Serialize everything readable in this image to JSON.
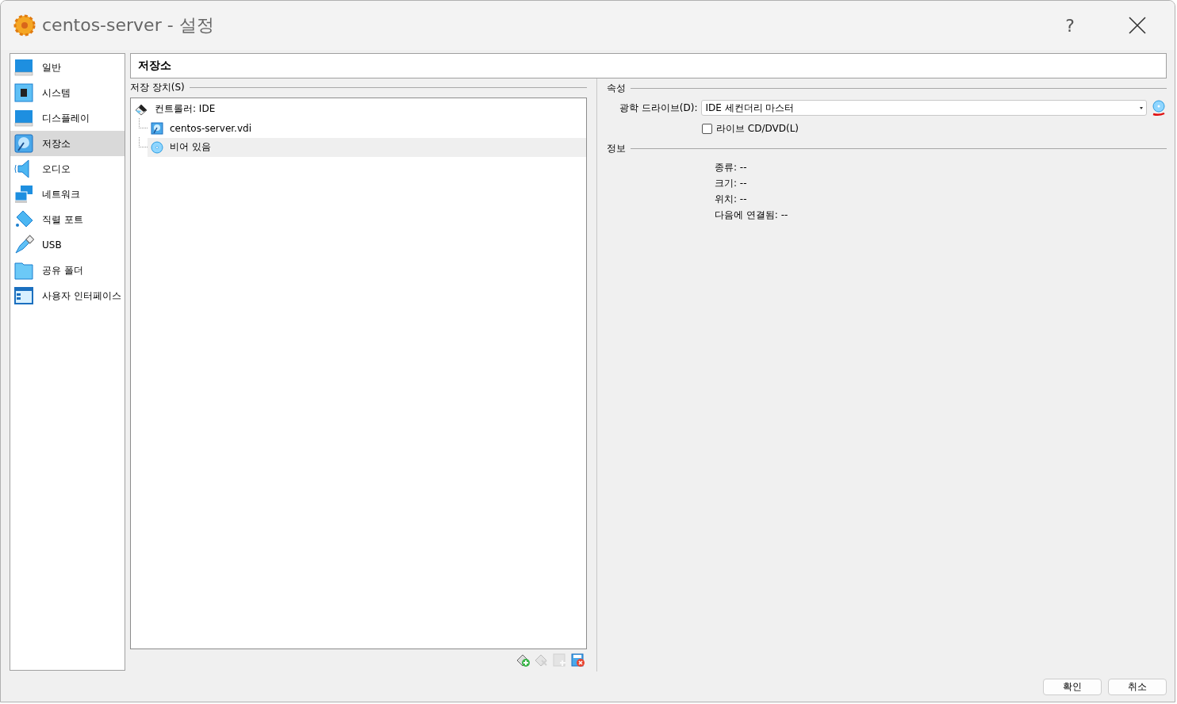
{
  "window": {
    "title": "centos-server - 설정",
    "help": "?"
  },
  "sidebar": {
    "items": [
      {
        "label": "일반",
        "selected": false
      },
      {
        "label": "시스템",
        "selected": false
      },
      {
        "label": "디스플레이",
        "selected": false
      },
      {
        "label": "저장소",
        "selected": true
      },
      {
        "label": "오디오",
        "selected": false
      },
      {
        "label": "네트워크",
        "selected": false
      },
      {
        "label": "직렬 포트",
        "selected": false
      },
      {
        "label": "USB",
        "selected": false
      },
      {
        "label": "공유 폴더",
        "selected": false
      },
      {
        "label": "사용자 인터페이스",
        "selected": false
      }
    ]
  },
  "page_title": "저장소",
  "storage": {
    "title": "저장 장치(S)",
    "tree": [
      {
        "label": "컨트롤러: IDE",
        "kind": "controller",
        "selected": false,
        "children": [
          {
            "label": "centos-server.vdi",
            "kind": "disk",
            "selected": false
          },
          {
            "label": "비어 있음",
            "kind": "optical",
            "selected": true
          }
        ]
      }
    ],
    "toolbar": [
      {
        "kind": "add-controller",
        "disabled": false
      },
      {
        "kind": "remove-controller",
        "disabled": true
      },
      {
        "kind": "add-attachment",
        "disabled": true
      },
      {
        "kind": "remove-attachment",
        "disabled": false
      }
    ]
  },
  "attributes": {
    "title": "속성",
    "drive_label": "광학 드라이브(D):",
    "drive_value": "IDE 세컨더리 마스터",
    "live_cd": {
      "label": "라이브 CD/DVD(L)",
      "checked": false
    }
  },
  "information": {
    "title": "정보",
    "rows": [
      "종류: --",
      "크기: --",
      "위치: --",
      "다음에 연결됨: --"
    ]
  },
  "buttons": [
    "확인",
    "취소"
  ]
}
